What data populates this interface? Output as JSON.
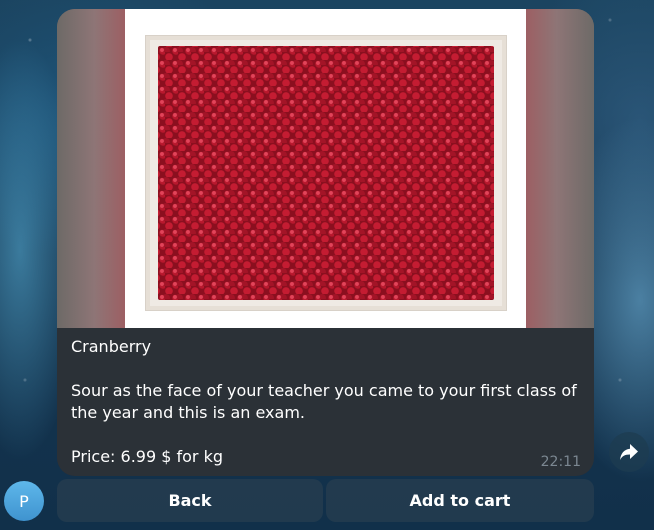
{
  "message": {
    "title": "Cranberry",
    "description": "Sour as the face of your teacher you came to your first class of the year and this is an exam.",
    "price": "Price: 6.99 $ for kg",
    "time": "22:11"
  },
  "avatar": {
    "initial": "P",
    "color": "#4fa6de"
  },
  "keyboard": {
    "back_label": "Back",
    "add_to_cart_label": "Add to cart"
  },
  "icons": {
    "share": "share-arrow-icon"
  },
  "colors": {
    "bubble_bg": "#2b3137",
    "time_text": "#7b8791",
    "button_bg": "#263e50"
  }
}
